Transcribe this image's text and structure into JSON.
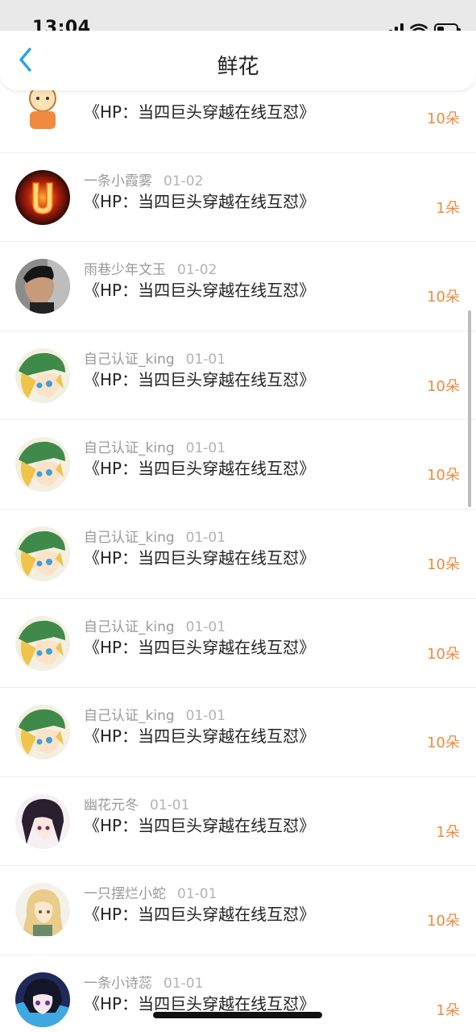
{
  "status_bar": {
    "time": "13:04"
  },
  "header": {
    "title": "鲜花",
    "back_icon": "chevron-left-icon",
    "accent_color": "#2aa3e8"
  },
  "colors": {
    "amount": "#f08a3e",
    "name": "#9a9a9a"
  },
  "list": [
    {
      "name": "",
      "date": "",
      "book": "《HP：当四巨头穿越在线互怼》",
      "amount": "10朵",
      "avatar": "cartoon-kid"
    },
    {
      "name": "一条小霞雾",
      "date": "01-02",
      "book": "《HP：当四巨头穿越在线互怼》",
      "amount": "1朵",
      "avatar": "fire-u"
    },
    {
      "name": "雨巷少年文玉",
      "date": "01-02",
      "book": "《HP：当四巨头穿越在线互怼》",
      "amount": "10朵",
      "avatar": "photo-person"
    },
    {
      "name": "自己认证_king",
      "date": "01-01",
      "book": "《HP：当四巨头穿越在线互怼》",
      "amount": "10朵",
      "avatar": "anime-green"
    },
    {
      "name": "自己认证_king",
      "date": "01-01",
      "book": "《HP：当四巨头穿越在线互怼》",
      "amount": "10朵",
      "avatar": "anime-green"
    },
    {
      "name": "自己认证_king",
      "date": "01-01",
      "book": "《HP：当四巨头穿越在线互怼》",
      "amount": "10朵",
      "avatar": "anime-green"
    },
    {
      "name": "自己认证_king",
      "date": "01-01",
      "book": "《HP：当四巨头穿越在线互怼》",
      "amount": "10朵",
      "avatar": "anime-green"
    },
    {
      "name": "自己认证_king",
      "date": "01-01",
      "book": "《HP：当四巨头穿越在线互怼》",
      "amount": "10朵",
      "avatar": "anime-green"
    },
    {
      "name": "幽花元冬",
      "date": "01-01",
      "book": "《HP：当四巨头穿越在线互怼》",
      "amount": "1朵",
      "avatar": "anime-dark"
    },
    {
      "name": "一只摆烂小蛇",
      "date": "01-01",
      "book": "《HP：当四巨头穿越在线互怼》",
      "amount": "10朵",
      "avatar": "anime-blonde"
    },
    {
      "name": "一条小诗蕊",
      "date": "01-01",
      "book": "《HP：当四巨头穿越在线互怼》",
      "amount": "1朵",
      "avatar": "anime-blue"
    }
  ]
}
